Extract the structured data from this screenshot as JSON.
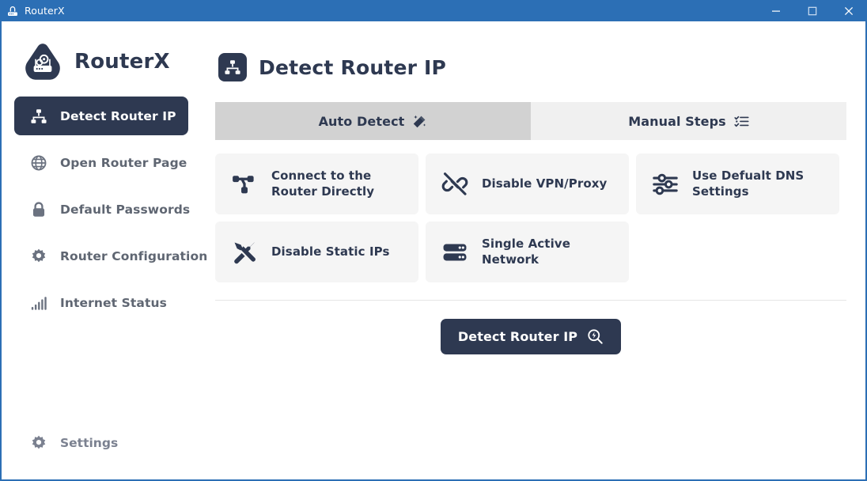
{
  "window": {
    "title": "RouterX",
    "icon": "router-icon",
    "accent_color": "#2c6fb5",
    "controls": [
      {
        "name": "minimize",
        "glyph": "minimize-icon"
      },
      {
        "name": "maximize",
        "glyph": "maximize-icon"
      },
      {
        "name": "close",
        "glyph": "close-icon"
      }
    ]
  },
  "sidebar": {
    "brand": {
      "name": "RouterX",
      "logo_icon": "routerx-logo-icon"
    },
    "items": [
      {
        "label": "Detect Router IP",
        "icon": "sitemap-icon",
        "active": true
      },
      {
        "label": "Open Router Page",
        "icon": "globe-icon",
        "active": false
      },
      {
        "label": "Default Passwords",
        "icon": "lock-icon",
        "active": false
      },
      {
        "label": "Router Configuration",
        "icon": "gear-icon",
        "active": false
      },
      {
        "label": "Internet Status",
        "icon": "signal-bars-icon",
        "active": false
      }
    ],
    "bottom": {
      "label": "Settings",
      "icon": "gear-icon"
    },
    "active_bg": "#2e3951",
    "item_color": "#5f6672"
  },
  "main": {
    "header": {
      "title": "Detect Router IP",
      "icon": "sitemap-icon"
    },
    "tabs": [
      {
        "label": "Auto Detect",
        "icon": "magic-wand-icon",
        "active": true
      },
      {
        "label": "Manual Steps",
        "icon": "list-checks-icon",
        "active": false
      }
    ],
    "cards": [
      {
        "label": "Connect to the\nRouter Directly",
        "icon": "share-nodes-icon"
      },
      {
        "label": "Disable VPN/Proxy",
        "icon": "unlink-icon"
      },
      {
        "label": "Use Defualt DNS\nSettings",
        "icon": "sliders-icon"
      },
      {
        "label": "Disable Static IPs",
        "icon": "tools-icon"
      },
      {
        "label": "Single Active\nNetwork",
        "icon": "server-icon"
      }
    ],
    "action": {
      "label": "Detect Router IP",
      "icon": "search-bolt-icon",
      "bg": "#2e3951"
    }
  }
}
